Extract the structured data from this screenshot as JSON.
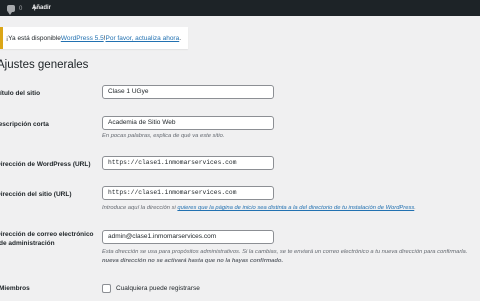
{
  "adminbar": {
    "comments_count": "0",
    "new_label": "Añadir"
  },
  "notice": {
    "text_before": "¡Ya está disponible ",
    "version_link": "WordPress 5.5",
    "text_middle": "! ",
    "update_link": "Por favor, actualiza ahora",
    "text_after": "."
  },
  "page": {
    "title": "Ajustes generales"
  },
  "fields": {
    "site_title": {
      "label": "Título del sitio",
      "value": "Clase 1 UGye"
    },
    "tagline": {
      "label": "Descripción corta",
      "value": "Academia de Sitio Web",
      "description": "En pocas palabras, explica de qué va este sitio."
    },
    "wp_url": {
      "label": "Dirección de WordPress (URL)",
      "value": "https://clase1.inmomarservices.com"
    },
    "site_url": {
      "label": "Dirección del sitio (URL)",
      "value": "https://clase1.inmomarservices.com",
      "description_before": "Introduce aquí la dirección si ",
      "description_link": "quieres que la página de inicio sea distinta a la del directorio de tu instalación de WordPress",
      "description_after": "."
    },
    "admin_email": {
      "label_line1": "Dirección de correo electrónico",
      "label_line2": "de administración",
      "value": "admin@clase1.inmomarservices.com",
      "description_line1": "Esta dirección se usa para propósitos administrativos. Si la cambias, se te enviará un correo electrónico a tu nueva dirección para confirmarla.",
      "description_line2": "nueva dirección no se activará hasta que no la hayas confirmado."
    },
    "membership": {
      "label": "Miembros",
      "checkbox_label": "Cualquiera puede registrarse",
      "checked": false
    }
  },
  "colors": {
    "adminbar_bg": "#1d2327",
    "page_bg": "#f0f0f1",
    "link": "#2271b1",
    "notice_border": "#dba617"
  }
}
